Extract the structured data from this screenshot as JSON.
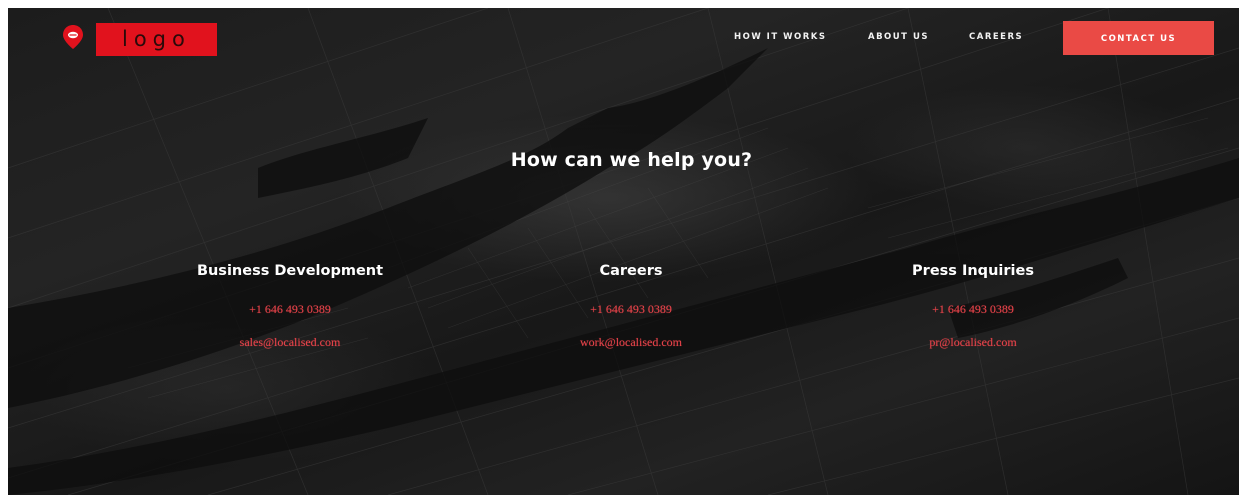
{
  "header": {
    "logo_text": "logo",
    "logo_icon": "map-pin-icon",
    "nav": [
      {
        "label": "HOW IT WORKS"
      },
      {
        "label": "ABOUT US"
      },
      {
        "label": "CAREERS"
      }
    ],
    "contact_label": "CONTACT US"
  },
  "main": {
    "headline": "How can we help you?",
    "columns": [
      {
        "title": "Business Development",
        "phone": "+1 646 493 0389",
        "email": "sales@localised.com"
      },
      {
        "title": "Careers",
        "phone": "+1 646 493 0389",
        "email": "work@localised.com"
      },
      {
        "title": "Press Inquiries",
        "phone": "+1 646 493 0389",
        "email": "pr@localised.com"
      }
    ]
  },
  "colors": {
    "accent": "#e1121d",
    "button": "#ea4a45",
    "link": "#e8434a",
    "background": "#1e1e1e"
  }
}
